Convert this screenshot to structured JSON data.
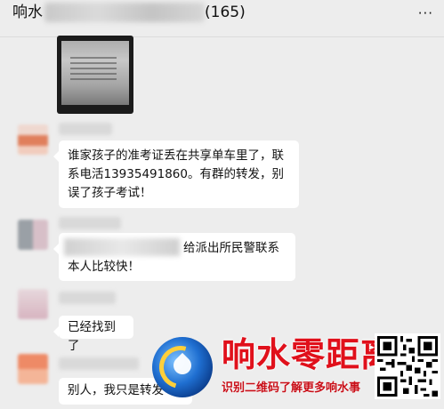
{
  "header": {
    "title_prefix": "响水",
    "member_count": "(165)",
    "more_label": "···"
  },
  "messages": [
    {
      "text": "谁家孩子的准考证丢在共享单车里了，联系电活13935491860。有群的转发，别误了孩子考试！"
    },
    {
      "line1": "给派出所民警联系",
      "line2": "本人比较快！"
    },
    {
      "text": "已经找到了"
    },
    {
      "text": "别人，我只是转发"
    }
  ],
  "watermark": {
    "title": "响水零距离",
    "subtitle": "识别二维码了解更多响水事",
    "accent_color": "#e0101b",
    "logo_icon": "water-drop-logo-icon",
    "qr_icon": "qr-code-icon"
  }
}
